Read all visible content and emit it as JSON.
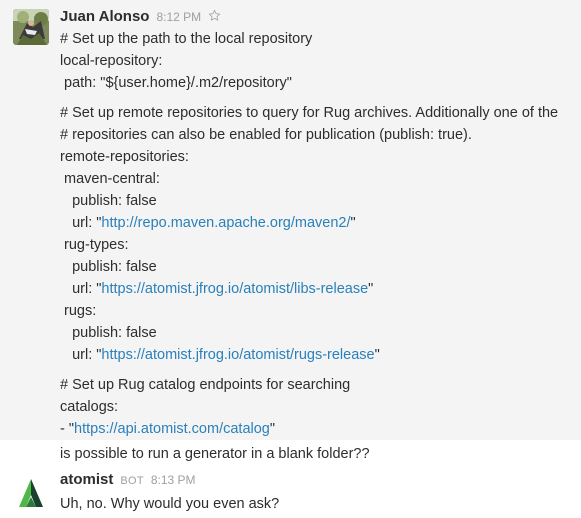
{
  "messages": [
    {
      "user": "Juan Alonso",
      "time": "8:12 PM",
      "lines": [
        "# Set up the path to the local repository",
        "local-repository:",
        " path: \"${user.home}/.m2/repository\"",
        "# Set up remote repositories to query for Rug archives. Additionally one of the",
        "# repositories can also be enabled for publication (publish: true).",
        "remote-repositories:",
        " maven-central:",
        "   publish: false"
      ],
      "url_lines": [
        {
          "prefix": "   url: \"",
          "link": "http://repo.maven.apache.org/maven2/",
          "suffix": "\""
        },
        {
          "prefix": "   url: \"",
          "link": "https://atomist.jfrog.io/atomist/libs-release",
          "suffix": "\""
        },
        {
          "prefix": "   url: \"",
          "link": "https://atomist.jfrog.io/atomist/rugs-release",
          "suffix": "\""
        },
        {
          "prefix": "- \"",
          "link": "https://api.atomist.com/catalog",
          "suffix": "\""
        }
      ],
      "lines2": [
        " rug-types:",
        "   publish: false",
        " rugs:",
        "   publish: false",
        "# Set up Rug catalog endpoints for searching",
        "catalogs:"
      ]
    },
    {
      "text": "is possible to run a generator in a blank folder??"
    },
    {
      "user": "atomist",
      "badge": "BOT",
      "time": "8:13 PM",
      "text": "Uh, no. Why would you even ask?"
    }
  ]
}
